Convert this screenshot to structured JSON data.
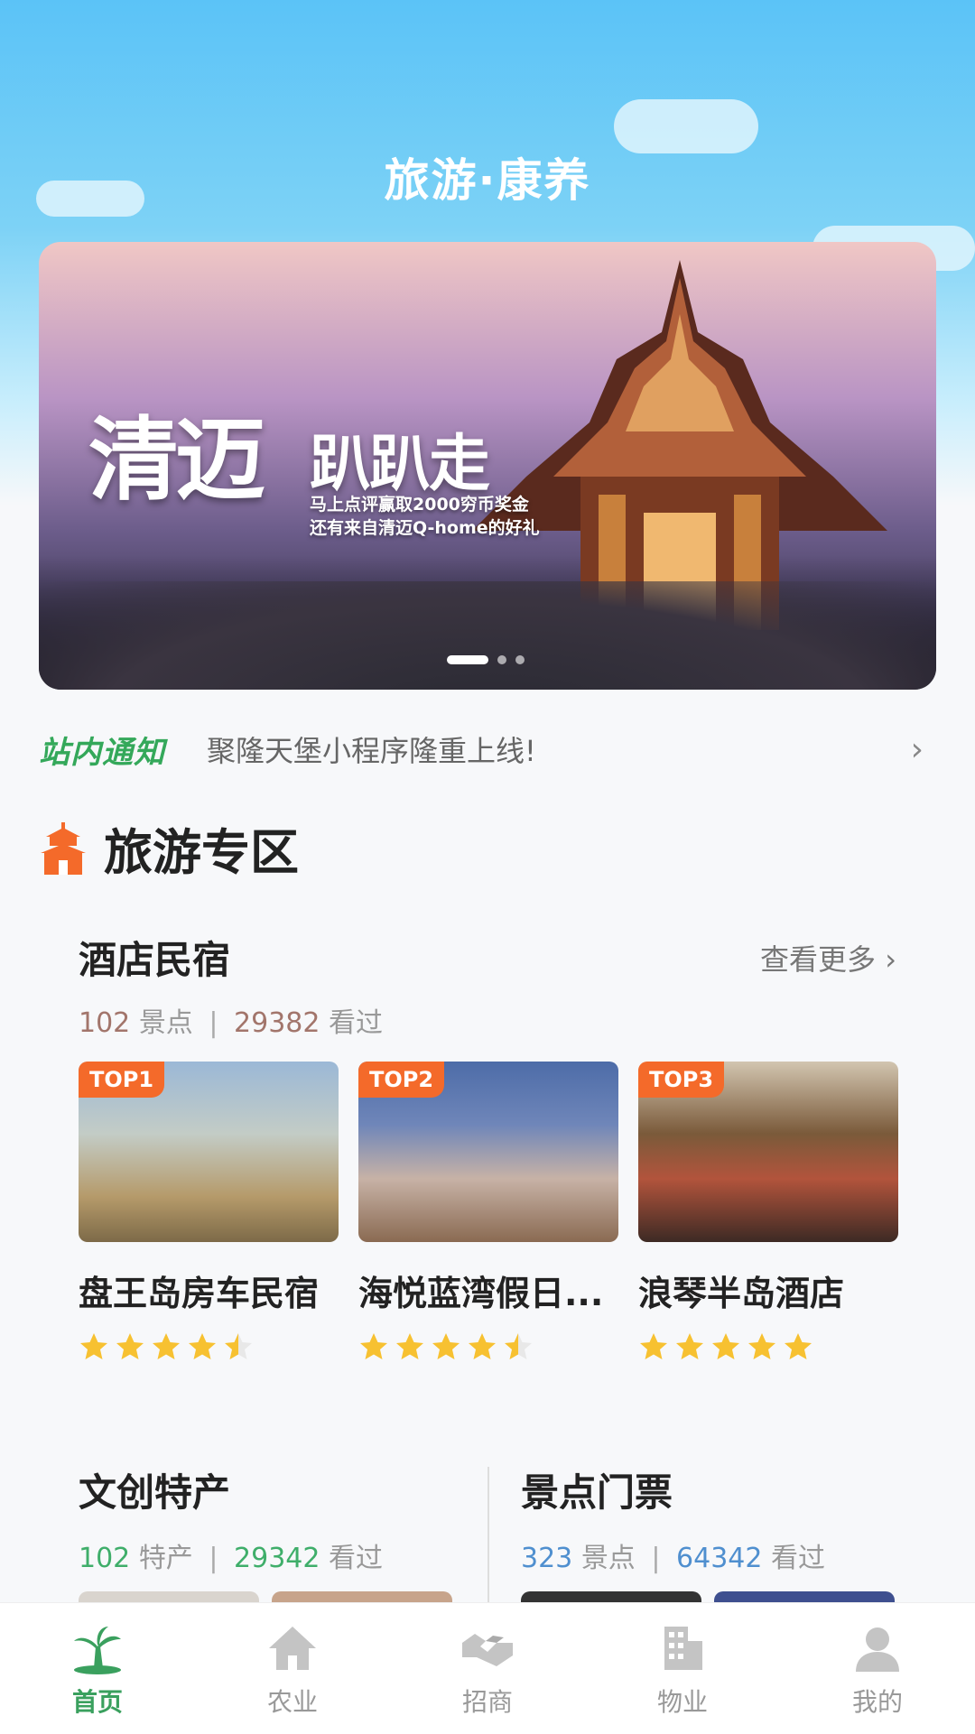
{
  "app": {
    "title": "旅游·康养"
  },
  "banner": {
    "big_title": "清迈",
    "big_sub": "趴趴走",
    "promo_line1": "马上点评赢取2000穷币奖金",
    "promo_line2": "还有来自清迈Q-home的好礼",
    "slides_total": 3,
    "active_slide": 1
  },
  "notice": {
    "tag": "站内通知",
    "text": "聚隆天堡小程序隆重上线!"
  },
  "section": {
    "title": "旅游专区"
  },
  "hotel": {
    "title": "酒店民宿",
    "more": "查看更多",
    "count": "102",
    "count_label": "景点",
    "views": "29382",
    "views_label": "看过",
    "items": [
      {
        "badge": "TOP1",
        "name": "盘王岛房车民宿",
        "rating": 4.5
      },
      {
        "badge": "TOP2",
        "name": "海悦蓝湾假日...",
        "rating": 4.5
      },
      {
        "badge": "TOP3",
        "name": "浪琴半岛酒店",
        "rating": 5
      }
    ]
  },
  "culture": {
    "title": "文创特产",
    "count": "102",
    "count_label": "特产",
    "views": "29342",
    "views_label": "看过"
  },
  "tickets": {
    "title": "景点门票",
    "count": "323",
    "count_label": "景点",
    "views": "64342",
    "views_label": "看过"
  },
  "tabbar": [
    {
      "label": "首页",
      "icon": "palm-tree-icon",
      "active": true
    },
    {
      "label": "农业",
      "icon": "house-icon",
      "active": false
    },
    {
      "label": "招商",
      "icon": "handshake-icon",
      "active": false
    },
    {
      "label": "物业",
      "icon": "building-icon",
      "active": false
    },
    {
      "label": "我的",
      "icon": "person-icon",
      "active": false
    }
  ],
  "colors": {
    "accent_green": "#3aa05e",
    "badge_orange": "#f46a2a",
    "star_yellow": "#f7c131",
    "culture_green": "#3fae6a",
    "ticket_blue": "#4f8fcf"
  }
}
